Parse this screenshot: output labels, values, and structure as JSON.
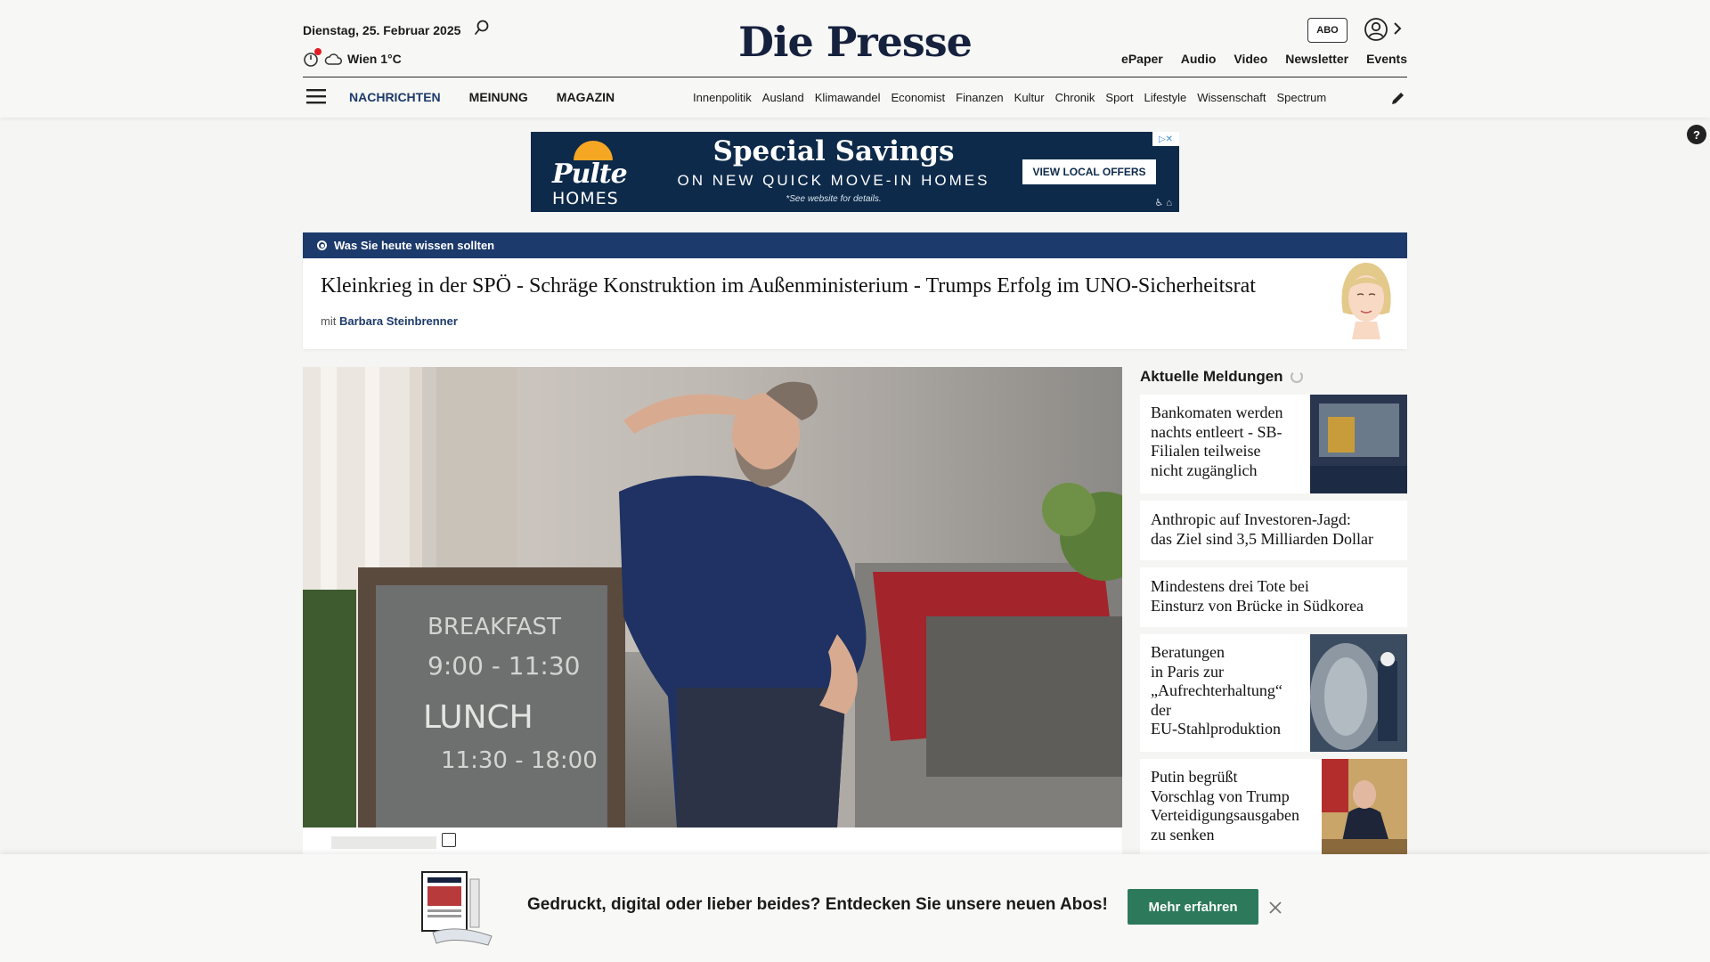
{
  "header": {
    "date": "Dienstag, 25. Februar 2025",
    "weather": "Wien 1°C",
    "logo": "Die Presse",
    "abo_label": "ABO",
    "top_links": [
      "ePaper",
      "Audio",
      "Video",
      "Newsletter",
      "Events"
    ],
    "main_nav": [
      "NACHRICHTEN",
      "MEINUNG",
      "MAGAZIN"
    ],
    "sub_nav": [
      "Innenpolitik",
      "Ausland",
      "Klimawandel",
      "Economist",
      "Finanzen",
      "Kultur",
      "Chronik",
      "Sport",
      "Lifestyle",
      "Wissenschaft",
      "Spectrum"
    ]
  },
  "ad": {
    "brand_top": "Pulte",
    "brand_bottom": "HOMES",
    "title": "Special Savings",
    "subtitle": "ON NEW QUICK MOVE-IN HOMES",
    "note": "*See website for details.",
    "button": "VIEW LOCAL OFFERS"
  },
  "briefing": {
    "label": "Was Sie heute wissen sollten",
    "title": "Kleinkrieg in der SPÖ - Schräge Konstruktion im Außenministerium - Trumps Erfolg im UNO-Sicherheitsrat",
    "by_prefix": "mit",
    "author": "Barbara Steinbrenner"
  },
  "hero": {
    "board_lines": [
      "BREAKFAST",
      "9:00 - 11:30",
      "LUNCH",
      "11:30 - 18:00"
    ]
  },
  "news": {
    "heading": "Aktuelle Meldungen",
    "items": [
      {
        "title_lines": [
          "Bankomaten werden",
          "nachts entleert - SB-",
          "Filialen teilweise",
          "nicht zugänglich"
        ]
      },
      {
        "title_lines": [
          "Anthropic auf Investoren-Jagd:",
          "das Ziel sind 3,5 Milliarden Dollar"
        ]
      },
      {
        "title_lines": [
          "Mindestens drei Tote bei",
          "Einsturz von Brücke in Südkorea"
        ]
      },
      {
        "title_lines": [
          "Beratungen",
          "in Paris zur",
          "„Aufrechterhaltung“",
          "der",
          "EU-Stahlproduktion"
        ]
      },
      {
        "title_lines": [
          "Putin begrüßt",
          "Vorschlag von Trump",
          "Verteidigungsausgaben",
          "zu senken"
        ]
      }
    ]
  },
  "promo": {
    "text": "Gedruckt, digital oder lieber beides? Entdecken Sie unsere neuen Abos!",
    "button": "Mehr erfahren"
  },
  "colors": {
    "brand_navy": "#1c3a6b",
    "promo_green": "#2c7a5b",
    "notification_red": "#e31b23"
  }
}
